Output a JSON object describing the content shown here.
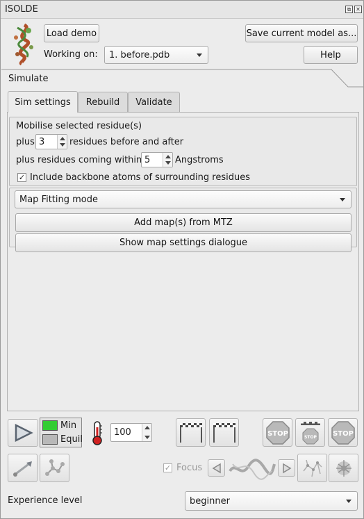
{
  "window": {
    "title": "ISOLDE"
  },
  "header": {
    "load_demo": "Load demo",
    "save_model": "Save current model as...",
    "working_on_label": "Working on:",
    "working_on_value": "1. before.pdb",
    "help": "Help"
  },
  "section": {
    "title": "Simulate"
  },
  "tabs": [
    {
      "label": "Sim settings",
      "active": true
    },
    {
      "label": "Rebuild",
      "active": false
    },
    {
      "label": "Validate",
      "active": false
    }
  ],
  "sim_settings": {
    "mobilise_label": "Mobilise selected residue(s)",
    "plus_label": "plus",
    "plus_value": "3",
    "residues_label": "residues before and after",
    "within_label": "plus residues coming within",
    "within_value": "5",
    "angstroms_label": "Angstroms",
    "backbone_label": "Include backbone atoms of surrounding residues",
    "backbone_checked": true,
    "mode_value": "Map Fitting mode",
    "add_map_button": "Add map(s) from MTZ",
    "map_settings_button": "Show map settings dialogue"
  },
  "controls": {
    "min_label": "Min",
    "equil_label": "Equil",
    "temperature_value": "100",
    "focus_label": "Focus",
    "focus_checked": true,
    "stop_label": "STOP",
    "colors": {
      "min_active": "#33cc33",
      "equil_inactive": "#b8b8b8"
    }
  },
  "footer": {
    "experience_label": "Experience level",
    "experience_value": "beginner"
  }
}
